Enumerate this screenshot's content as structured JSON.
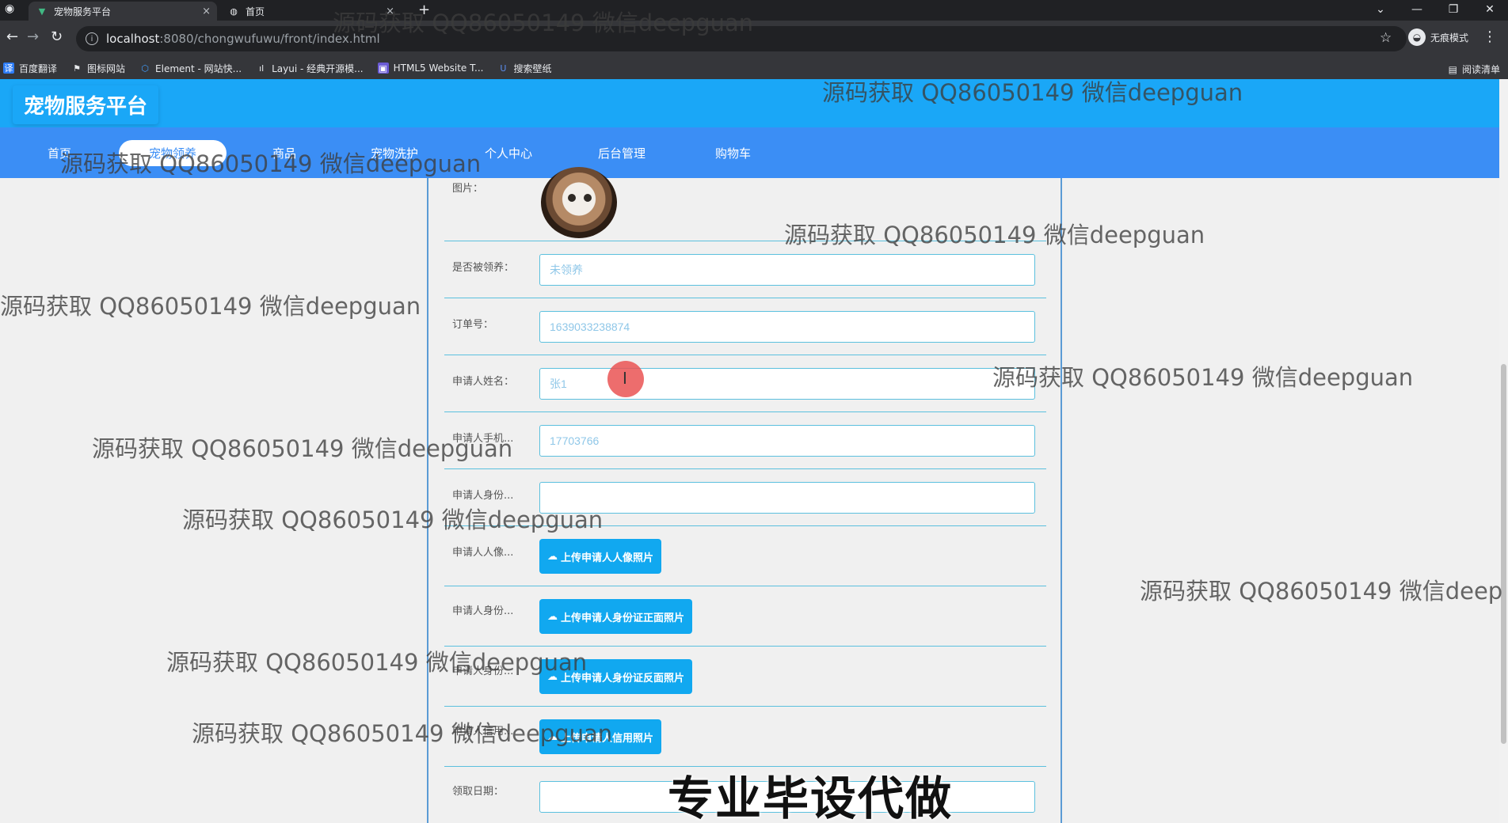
{
  "browser": {
    "tabs": [
      {
        "title": "宠物服务平台",
        "close": "×"
      },
      {
        "title": "首页",
        "close": "×"
      }
    ],
    "new_tab": "+",
    "window_controls": [
      "⌄",
      "—",
      "❐",
      "✕"
    ],
    "url_host": "localhost",
    "url_path": ":8080/chongwufuwu/front/index.html",
    "incognito_label": "无痕模式",
    "bookmarks": [
      "百度翻译",
      "图标网站",
      "Element - 网站快...",
      "Layui - 经典开源模...",
      "HTML5 Website T...",
      "搜索壁纸"
    ],
    "reading_list": "阅读清单"
  },
  "site": {
    "brand": "宠物服务平台",
    "nav": [
      "首页",
      "宠物领养",
      "商品",
      "宠物洗护",
      "个人中心",
      "后台管理",
      "购物车"
    ],
    "active_nav": "宠物领养"
  },
  "form": {
    "fields": [
      {
        "label": "图片：",
        "type": "image"
      },
      {
        "label": "是否被领养：",
        "type": "input",
        "value": "未领养"
      },
      {
        "label": "订单号：",
        "type": "input",
        "value": "1639033238874"
      },
      {
        "label": "申请人姓名：",
        "type": "input",
        "value": "张1"
      },
      {
        "label": "申请人手机...",
        "type": "input",
        "value": "17703766"
      },
      {
        "label": "申请人身份...",
        "type": "input",
        "value": ""
      },
      {
        "label": "申请人人像...",
        "type": "upload",
        "value": "上传申请人人像照片"
      },
      {
        "label": "申请人身份...",
        "type": "upload",
        "value": "上传申请人身份证正面照片"
      },
      {
        "label": "申请人身份...",
        "type": "upload",
        "value": "上传申请人身份证反面照片"
      },
      {
        "label": "申请人信用...",
        "type": "upload",
        "value": "上传申请人信用照片"
      },
      {
        "label": "领取日期：",
        "type": "input",
        "value": ""
      }
    ]
  },
  "watermark_text": "源码获取 QQ86050149 微信deepguan",
  "watermark_partial": "源码获取 QQ86050149 微信deep",
  "caption": "专业毕设代做",
  "colors": {
    "header": "#1aa7f7",
    "navbar": "#3b8ef5",
    "upload": "#11a8f0",
    "border": "#5bc0de"
  }
}
